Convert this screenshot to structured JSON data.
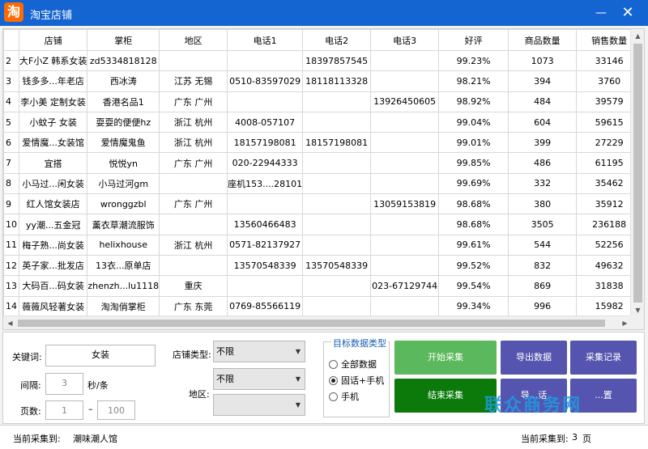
{
  "window": {
    "title": "淘宝店铺",
    "app_icon_glyph": "淘",
    "minimize_glyph": "—",
    "close_glyph": "✕"
  },
  "grid": {
    "columns": [
      "店铺",
      "掌柜",
      "地区",
      "电话1",
      "电话2",
      "电话3",
      "好评",
      "商品数量",
      "销售数量"
    ],
    "rows": [
      [
        "2",
        "大F小Z 韩系女装",
        "zd5334818128",
        "",
        "",
        "18397857545",
        "",
        "99.23%",
        "1073",
        "33146"
      ],
      [
        "3",
        "钱多多...年老店",
        "西冰涛",
        "江苏 无锡",
        "0510-83597029",
        "18118113328",
        "",
        "98.21%",
        "394",
        "3760"
      ],
      [
        "4",
        "李小美 定制女装",
        "香港名品1",
        "广东 广州",
        "",
        "",
        "13926450605",
        "98.92%",
        "484",
        "39579"
      ],
      [
        "5",
        "小蚊子 女装",
        "耍耍的便便hz",
        "浙江 杭州",
        "4008-057107",
        "",
        "",
        "99.04%",
        "604",
        "59615"
      ],
      [
        "6",
        "爱情魔...女装馆",
        "爱情魔鬼鱼",
        "浙江 杭州",
        "18157198081",
        "18157198081",
        "",
        "99.01%",
        "399",
        "27229"
      ],
      [
        "7",
        "宜搭",
        "悦悦yn",
        "广东 广州",
        "020-22944333",
        "",
        "",
        "99.85%",
        "486",
        "61195"
      ],
      [
        "8",
        "小马过...闲女装",
        "小马过河gm",
        "",
        "座机153....28101",
        "",
        "",
        "99.69%",
        "332",
        "35462"
      ],
      [
        "9",
        "红人馆女装店",
        "wronggzbl",
        "广东 广州",
        "",
        "",
        "13059153819",
        "98.68%",
        "380",
        "35912"
      ],
      [
        "10",
        "yy潮...五金冠",
        "薰衣草潮流服饰",
        "",
        "13560466483",
        "",
        "",
        "98.68%",
        "3505",
        "236188"
      ],
      [
        "11",
        "梅子熟...尚女装",
        "helixhouse",
        "浙江 杭州",
        "0571-82137927",
        "",
        "",
        "99.61%",
        "544",
        "52256"
      ],
      [
        "12",
        "英子家...批发店",
        "13衣...原单店",
        "",
        "13570548339",
        "13570548339",
        "",
        "99.52%",
        "832",
        "49632"
      ],
      [
        "13",
        "大码百...码女装",
        "zhenzh...lu1118",
        "重庆",
        "",
        "",
        "023-67129744",
        "99.54%",
        "869",
        "31838"
      ],
      [
        "14",
        "薇薇风轻著女装",
        "淘淘俏掌柜",
        "广东 东莞",
        "0769-85566119",
        "",
        "",
        "99.34%",
        "996",
        "15982"
      ]
    ]
  },
  "form": {
    "keyword_label": "关键词:",
    "keyword_value": "女装",
    "interval_label": "间隔:",
    "interval_value": "3",
    "interval_unit": "秒/条",
    "pages_label": "页数:",
    "pages_from": "1",
    "pages_sep": "–",
    "pages_to": "100",
    "shop_type_label": "店铺类型:",
    "shop_type_value": "不限",
    "region_label": "地区:",
    "region_value": "不限",
    "region2_value": ""
  },
  "target_group": {
    "title": "目标数据类型",
    "options": [
      {
        "label": "全部数据",
        "selected": false
      },
      {
        "label": "固话+手机",
        "selected": true
      },
      {
        "label": "手机",
        "selected": false
      }
    ]
  },
  "buttons": {
    "start": "开始采集",
    "export": "导出数据",
    "records": "采集记录",
    "stop": "结束采集",
    "import_partial": "导...话",
    "other_partial": "...置"
  },
  "status": {
    "current_label": "当前采集到:",
    "current_value": "潮味潮人馆",
    "page_label": "当前采集到:",
    "page_value": "3",
    "page_unit": "页"
  },
  "watermark": {
    "text": "联众商务网",
    "sub": ""
  },
  "colors": {
    "titlebar": "#1464d2",
    "start": "#5cb85c",
    "stop": "#0b7a0b",
    "purple": "#5555b0"
  }
}
